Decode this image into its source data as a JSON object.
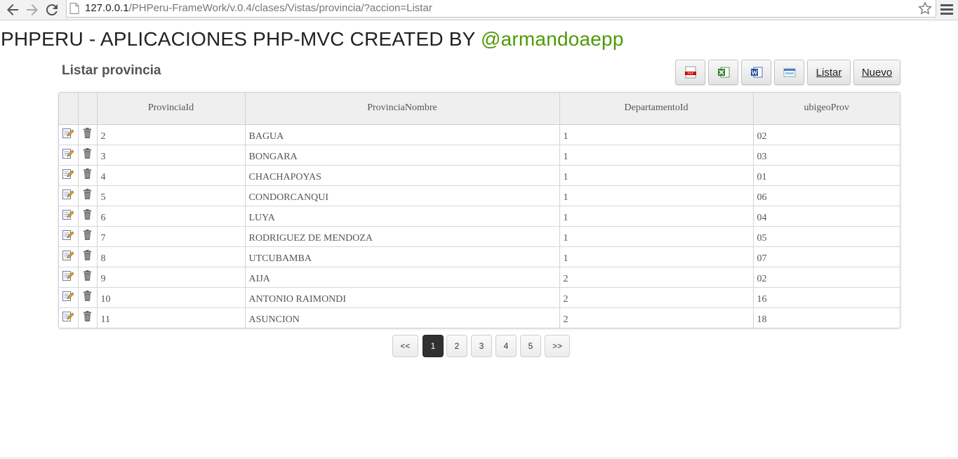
{
  "browser": {
    "url_host": "127.0.0.1",
    "url_path": "/PHPeru-FrameWork/v.0.4/clases/Vistas/provincia/?accion=Listar"
  },
  "app": {
    "title_prefix": "PHPERU - APLICACIONES PHP-MVC CREATED BY ",
    "title_author": "@armandoaepp",
    "author_color": "#4e9a06"
  },
  "section_title": "Listar provincia",
  "toolbar": {
    "icons": [
      "pdf-icon",
      "excel-icon",
      "word-icon",
      "html-icon"
    ],
    "list_label": "Listar",
    "new_label": "Nuevo"
  },
  "table": {
    "columns": [
      "ProvinciaId",
      "ProvinciaNombre",
      "DepartamentoId",
      "ubigeoProv"
    ],
    "rows": [
      [
        "2",
        "BAGUA",
        "1",
        "02"
      ],
      [
        "3",
        "BONGARA",
        "1",
        "03"
      ],
      [
        "4",
        "CHACHAPOYAS",
        "1",
        "01"
      ],
      [
        "5",
        "CONDORCANQUI",
        "1",
        "06"
      ],
      [
        "6",
        "LUYA",
        "1",
        "04"
      ],
      [
        "7",
        "RODRIGUEZ DE MENDOZA",
        "1",
        "05"
      ],
      [
        "8",
        "UTCUBAMBA",
        "1",
        "07"
      ],
      [
        "9",
        "AIJA",
        "2",
        "02"
      ],
      [
        "10",
        "ANTONIO RAIMONDI",
        "2",
        "16"
      ],
      [
        "11",
        "ASUNCION",
        "2",
        "18"
      ]
    ],
    "row_icons": [
      "edit-icon",
      "trash-icon"
    ]
  },
  "pagination": {
    "prev": "<<",
    "pages": [
      "1",
      "2",
      "3",
      "4",
      "5"
    ],
    "next": ">>",
    "current": "1"
  }
}
